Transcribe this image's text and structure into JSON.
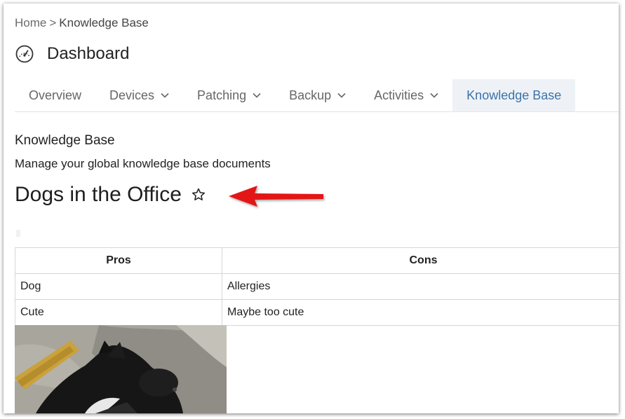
{
  "breadcrumb": {
    "home": "Home",
    "separator": ">",
    "current": "Knowledge Base"
  },
  "page": {
    "title": "Dashboard",
    "icon": "speedometer-icon"
  },
  "tabs": [
    {
      "label": "Overview",
      "dropdown": false,
      "active": false
    },
    {
      "label": "Devices",
      "dropdown": true,
      "active": false
    },
    {
      "label": "Patching",
      "dropdown": true,
      "active": false
    },
    {
      "label": "Backup",
      "dropdown": true,
      "active": false
    },
    {
      "label": "Activities",
      "dropdown": true,
      "active": false
    },
    {
      "label": "Knowledge Base",
      "dropdown": false,
      "active": true
    }
  ],
  "section": {
    "heading": "Knowledge Base",
    "subtitle": "Manage your global knowledge base documents"
  },
  "document": {
    "title": "Dogs in the Office",
    "favorite_icon": "star-outline-icon",
    "annotation_icon": "red-arrow-icon"
  },
  "table": {
    "headers": [
      "Pros",
      "Cons"
    ],
    "rows": [
      [
        "Dog",
        "Allergies"
      ],
      [
        "Cute",
        "Maybe too cute"
      ]
    ]
  },
  "image": {
    "subject": "photo-dog-sleeping"
  },
  "colors": {
    "accent": "#3d73a8",
    "active_tab_bg": "#eef2f7",
    "arrow": "#e31212"
  }
}
